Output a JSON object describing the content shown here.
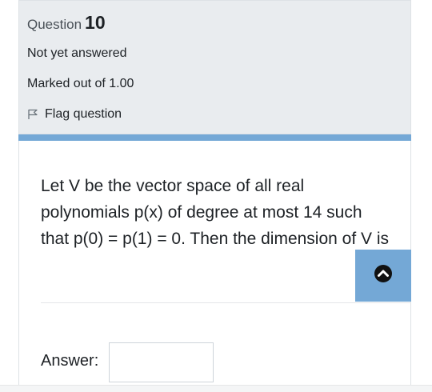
{
  "question_info": {
    "label": "Question",
    "number": "10",
    "state": "Not yet answered",
    "grade": "Marked out of 1.00",
    "flag_label": "Flag question"
  },
  "question": {
    "text": "Let V be the vector space of all real polynomials p(x) of degree at most 14 such that p(0) = p(1) = 0. Then the dimension of V is"
  },
  "answer": {
    "label": "Answer:",
    "value": ""
  },
  "icons": {
    "flag": "flag-icon",
    "scroll_top": "chevron-up-icon"
  },
  "colors": {
    "info_panel_bg": "#e9ecef",
    "accent_blue": "#74a8d6",
    "text": "#1d2125"
  }
}
